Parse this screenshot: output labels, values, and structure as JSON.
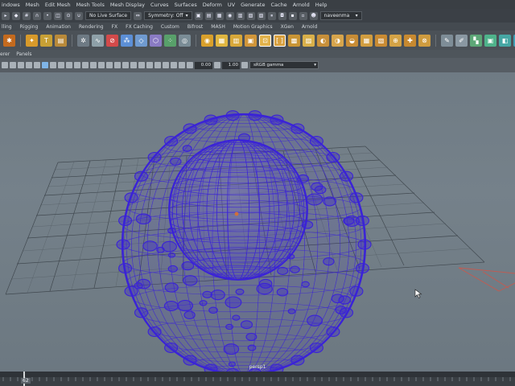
{
  "menus": [
    "indows",
    "Mesh",
    "Edit Mesh",
    "Mesh Tools",
    "Mesh Display",
    "Curves",
    "Surfaces",
    "Deform",
    "UV",
    "Generate",
    "Cache",
    "Arnold",
    "Help"
  ],
  "statusline": {
    "live_surface": "No Live Surface",
    "symmetry": "Symmetry: Off",
    "user": "naveenma"
  },
  "shelf_tabs": [
    "lling",
    "Rigging",
    "Animation",
    "Rendering",
    "FX",
    "FX Caching",
    "Custom",
    "Bifrost",
    "MASH",
    "Motion Graphics",
    "XGen",
    "Arnold"
  ],
  "panel_menu": [
    "erer",
    "Panels"
  ],
  "panel_toolbar": {
    "exposure": "0.00",
    "gamma_value": "1.00",
    "color_space": "sRGB gamma"
  },
  "viewport": {
    "camera": "persp1"
  },
  "timeslider": {
    "current_frame": "62"
  },
  "colors": {
    "wire": "#3a22d8",
    "grid": "#3f474d",
    "viewport_bg": "#717d86",
    "ui_dark": "#3a3f44"
  }
}
